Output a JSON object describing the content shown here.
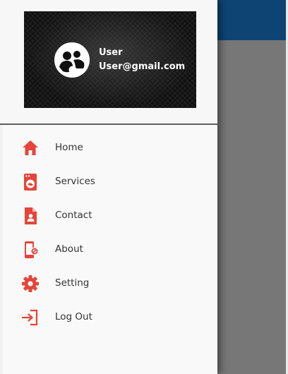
{
  "accent_color": "#e5453a",
  "app_bar_color": "#0d4473",
  "drawer": {
    "header": {
      "user_name": "User",
      "user_email": "User@gmail.com",
      "avatar_icon": "user-group-icon"
    },
    "menu": [
      {
        "label": "Home",
        "icon": "home-icon"
      },
      {
        "label": "Services",
        "icon": "washing-machine-icon"
      },
      {
        "label": "Contact",
        "icon": "contact-file-icon"
      },
      {
        "label": "About",
        "icon": "phone-blocked-icon"
      },
      {
        "label": "Setting",
        "icon": "gear-icon"
      },
      {
        "label": "Log Out",
        "icon": "logout-icon"
      }
    ]
  }
}
